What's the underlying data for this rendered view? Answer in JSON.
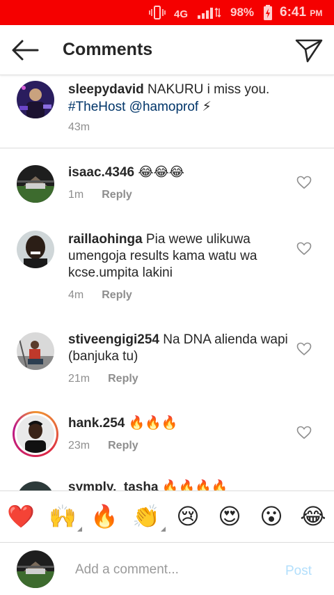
{
  "status_bar": {
    "network": "4G",
    "battery": "98%",
    "time": "6:41",
    "ampm": "PM"
  },
  "header": {
    "title": "Comments",
    "back_icon": "arrow-left-icon",
    "send_icon": "paper-plane-icon"
  },
  "caption": {
    "username": "sleepydavid",
    "text": " NAKURU i miss you. ",
    "hashtag": "#TheHost",
    "mention": "@hamoprof",
    "emoji": " ⚡",
    "time": "43m"
  },
  "comments": [
    {
      "username": "isaac.4346",
      "text": " 😂😂😂",
      "time": "1m",
      "reply": "Reply"
    },
    {
      "username": "raillaohinga",
      "text": " Pia wewe ulikuwa umengoja results kama watu wa kcse.umpita lakini",
      "time": "4m",
      "reply": "Reply"
    },
    {
      "username": "stiveengigi254",
      "text": " Na DNA alienda wapi (banjuka tu)",
      "time": "21m",
      "reply": "Reply"
    },
    {
      "username": "hank.254",
      "text": " 🔥🔥🔥",
      "time": "23m",
      "reply": "Reply"
    },
    {
      "username": "symply._tasha",
      "text": " 🔥🔥🔥🔥"
    }
  ],
  "emoji_bar": [
    "❤️",
    "🙌",
    "🔥",
    "👏",
    "😢",
    "😍",
    "😮",
    "😂"
  ],
  "input": {
    "placeholder": "Add a comment...",
    "post_label": "Post"
  },
  "colors": {
    "status_bar": "#f50000",
    "link": "#003569",
    "muted": "#8e8e8e",
    "post_disabled": "#b2dffc"
  }
}
